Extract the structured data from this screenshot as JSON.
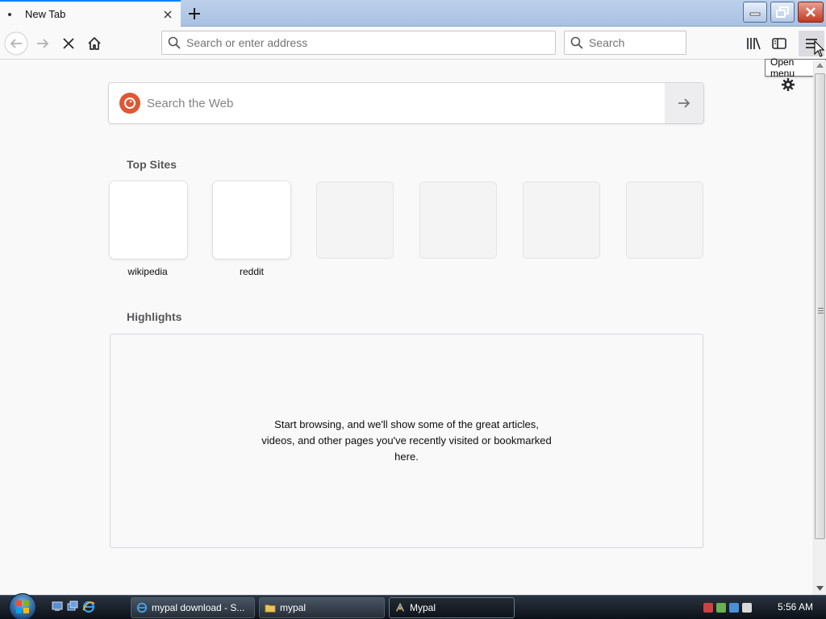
{
  "tab": {
    "title": "New Tab"
  },
  "nav": {
    "url_placeholder": "Search or enter address",
    "search_placeholder": "Search"
  },
  "tooltip": {
    "text": "Open menu"
  },
  "newtab": {
    "websearch_placeholder": "Search the Web",
    "topsites_title": "Top Sites",
    "topsites": [
      {
        "label": "wikipedia",
        "filled": true
      },
      {
        "label": "reddit",
        "filled": true
      },
      {
        "label": "",
        "filled": false
      },
      {
        "label": "",
        "filled": false
      },
      {
        "label": "",
        "filled": false
      },
      {
        "label": "",
        "filled": false
      }
    ],
    "highlights_title": "Highlights",
    "highlights_message": "Start browsing, and we'll show some of the great articles, videos, and other pages you've recently visited or bookmarked here."
  },
  "taskbar": {
    "buttons": [
      {
        "label": "mypal download - S...",
        "icon": "ie-icon",
        "active": false
      },
      {
        "label": "mypal",
        "icon": "folder-icon",
        "active": false
      },
      {
        "label": "Mypal",
        "icon": "mypal-app-icon",
        "active": true
      }
    ],
    "clock": "5:56 AM"
  },
  "colors": {
    "accent": "#0a84ff",
    "ddg": "#de5833",
    "close_button": "#c13a24"
  }
}
